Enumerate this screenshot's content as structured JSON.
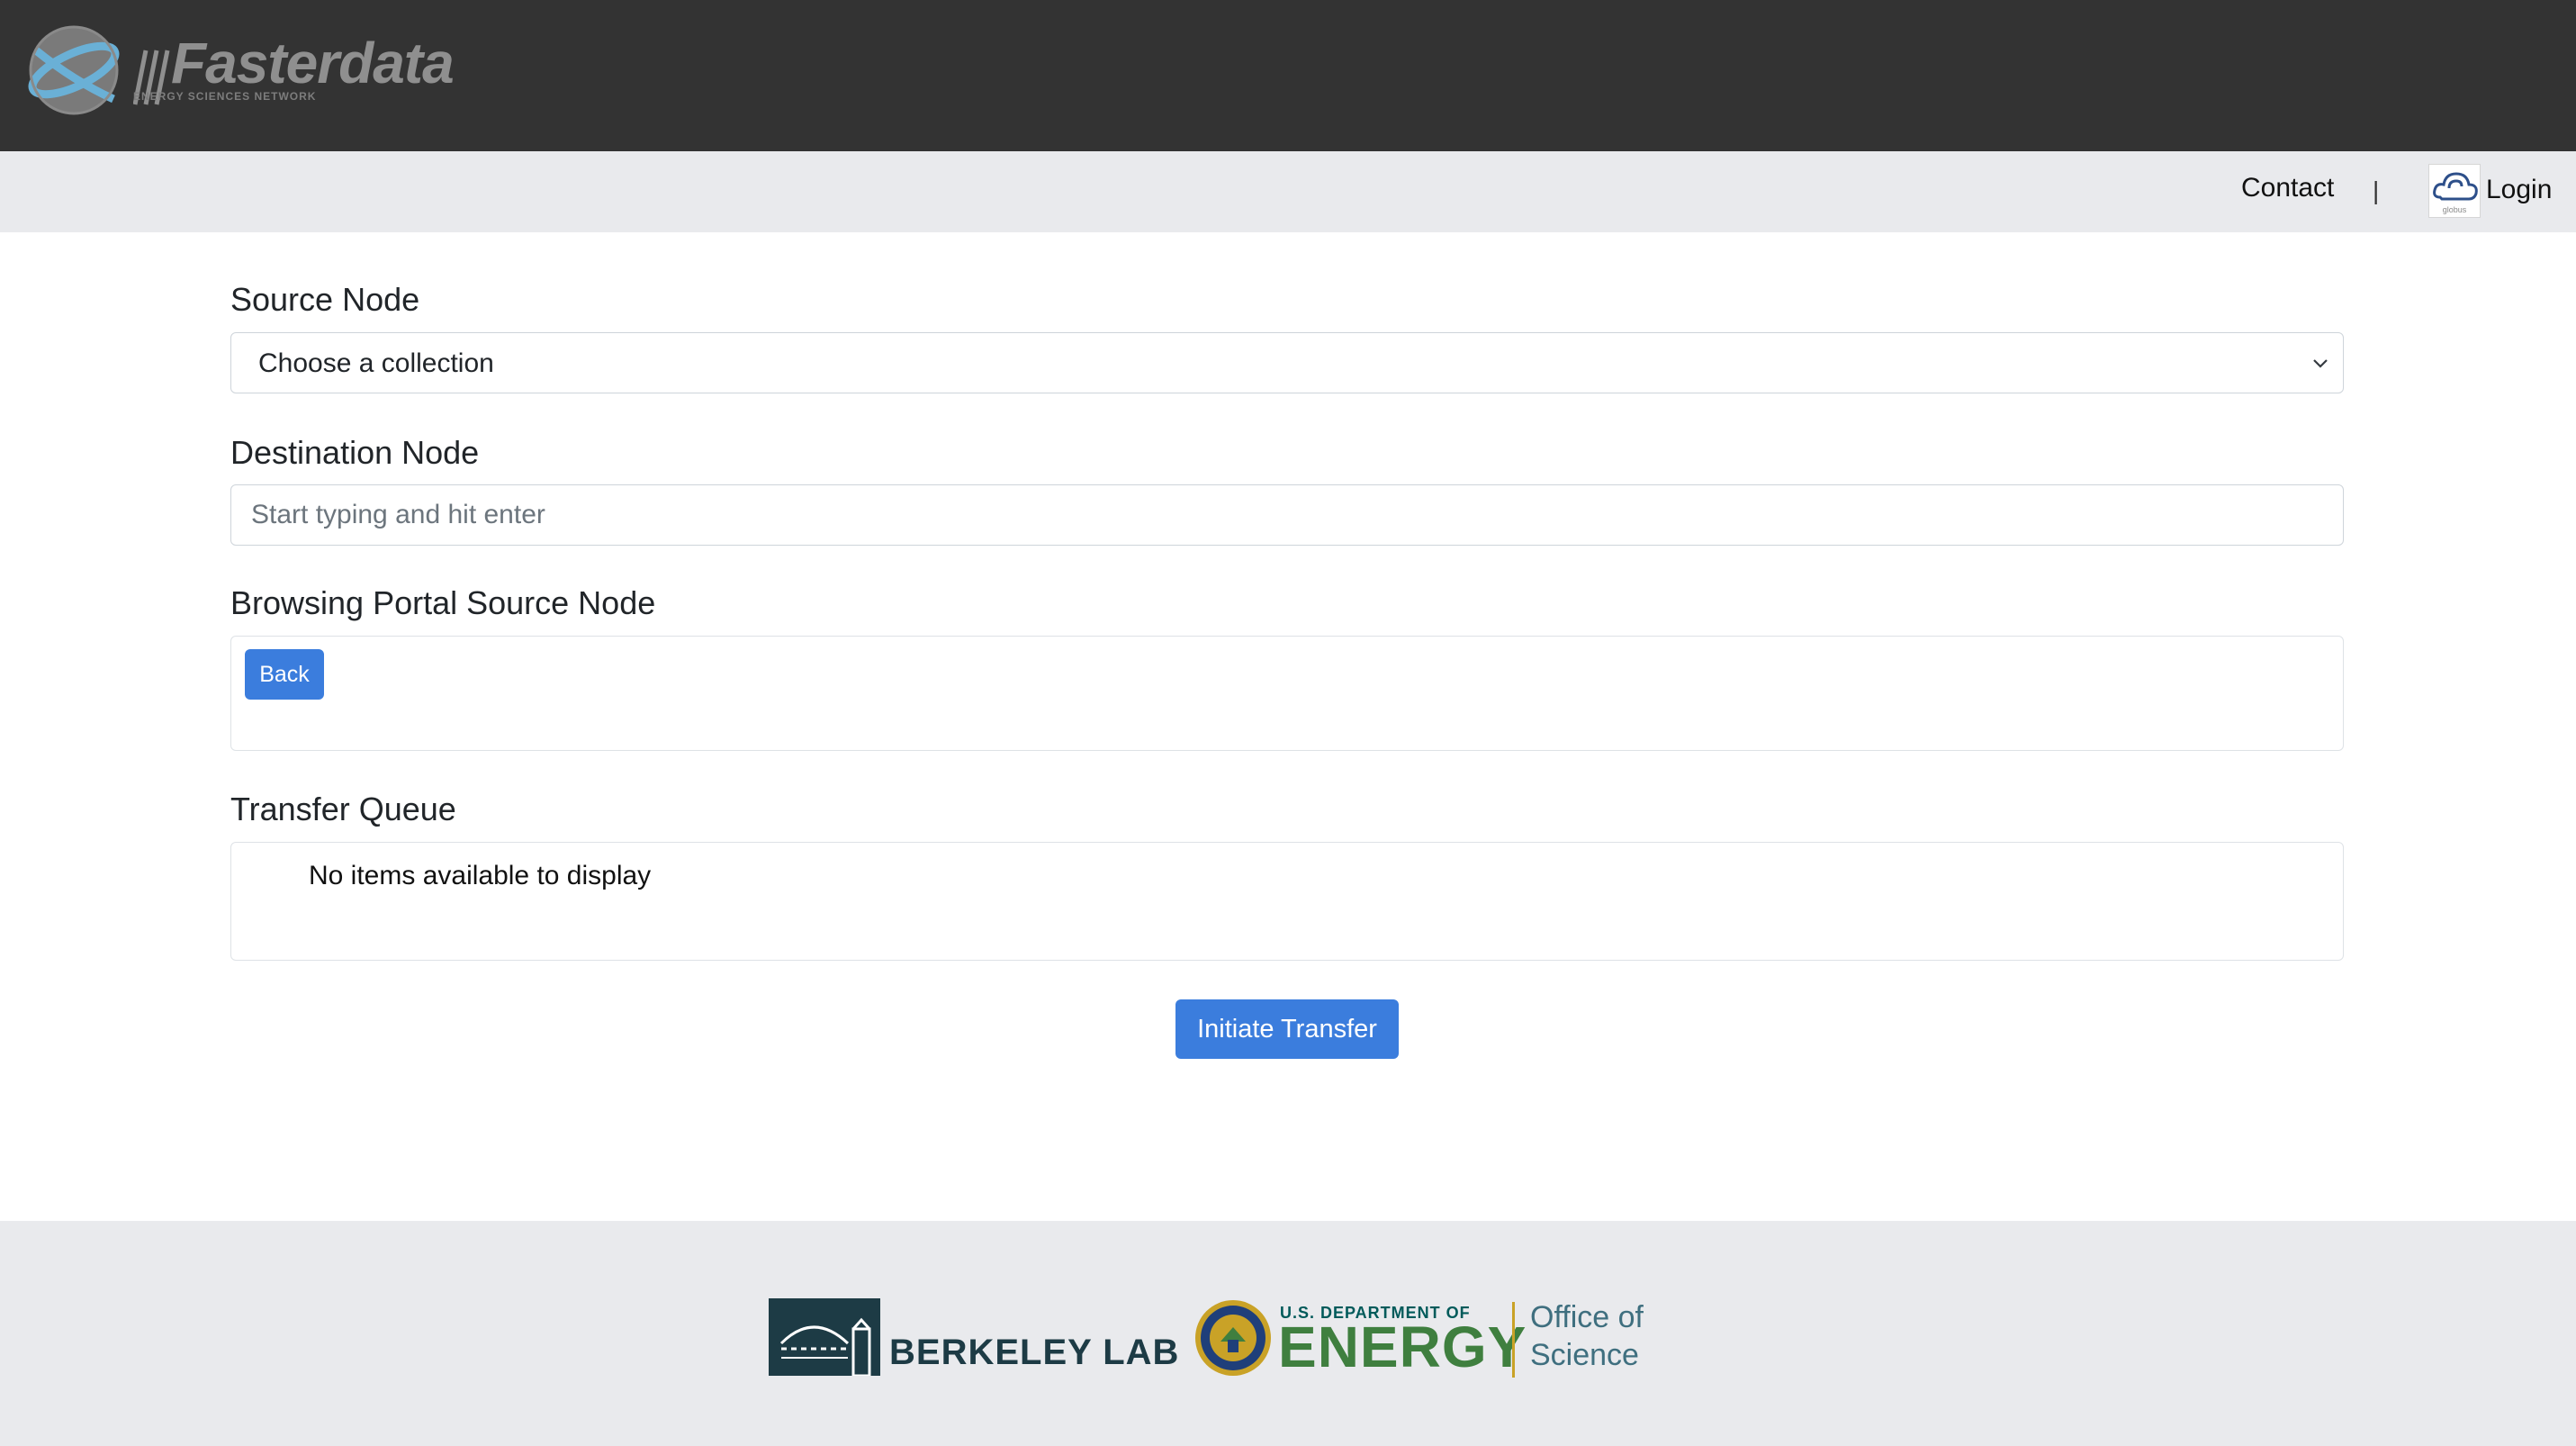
{
  "header": {
    "brand_name": "Fasterdata",
    "brand_subtitle": "ENERGY SCIENCES NETWORK"
  },
  "nav": {
    "contact_label": "Contact",
    "separator": "|",
    "login_label": "Login",
    "login_icon": "globus-icon",
    "login_icon_caption": "globus"
  },
  "source_node": {
    "label": "Source Node",
    "selected_value": "Choose a collection"
  },
  "destination_node": {
    "label": "Destination Node",
    "placeholder": "Start typing and hit enter",
    "value": ""
  },
  "browsing_portal": {
    "label": "Browsing Portal Source Node",
    "back_label": "Back"
  },
  "transfer_queue": {
    "label": "Transfer Queue",
    "empty_message": "No items available to display"
  },
  "actions": {
    "initiate_label": "Initiate Transfer"
  },
  "footer": {
    "berkeley_lab": "BERKELEY LAB",
    "doe_small": "U.S. DEPARTMENT OF",
    "doe_big": "ENERGY",
    "office_line1": "Office of",
    "office_line2": "Science"
  },
  "colors": {
    "topbar": "#333333",
    "navbar": "#e9eaed",
    "primary_button": "#3b7ddd",
    "footer": "#e9eaed"
  }
}
